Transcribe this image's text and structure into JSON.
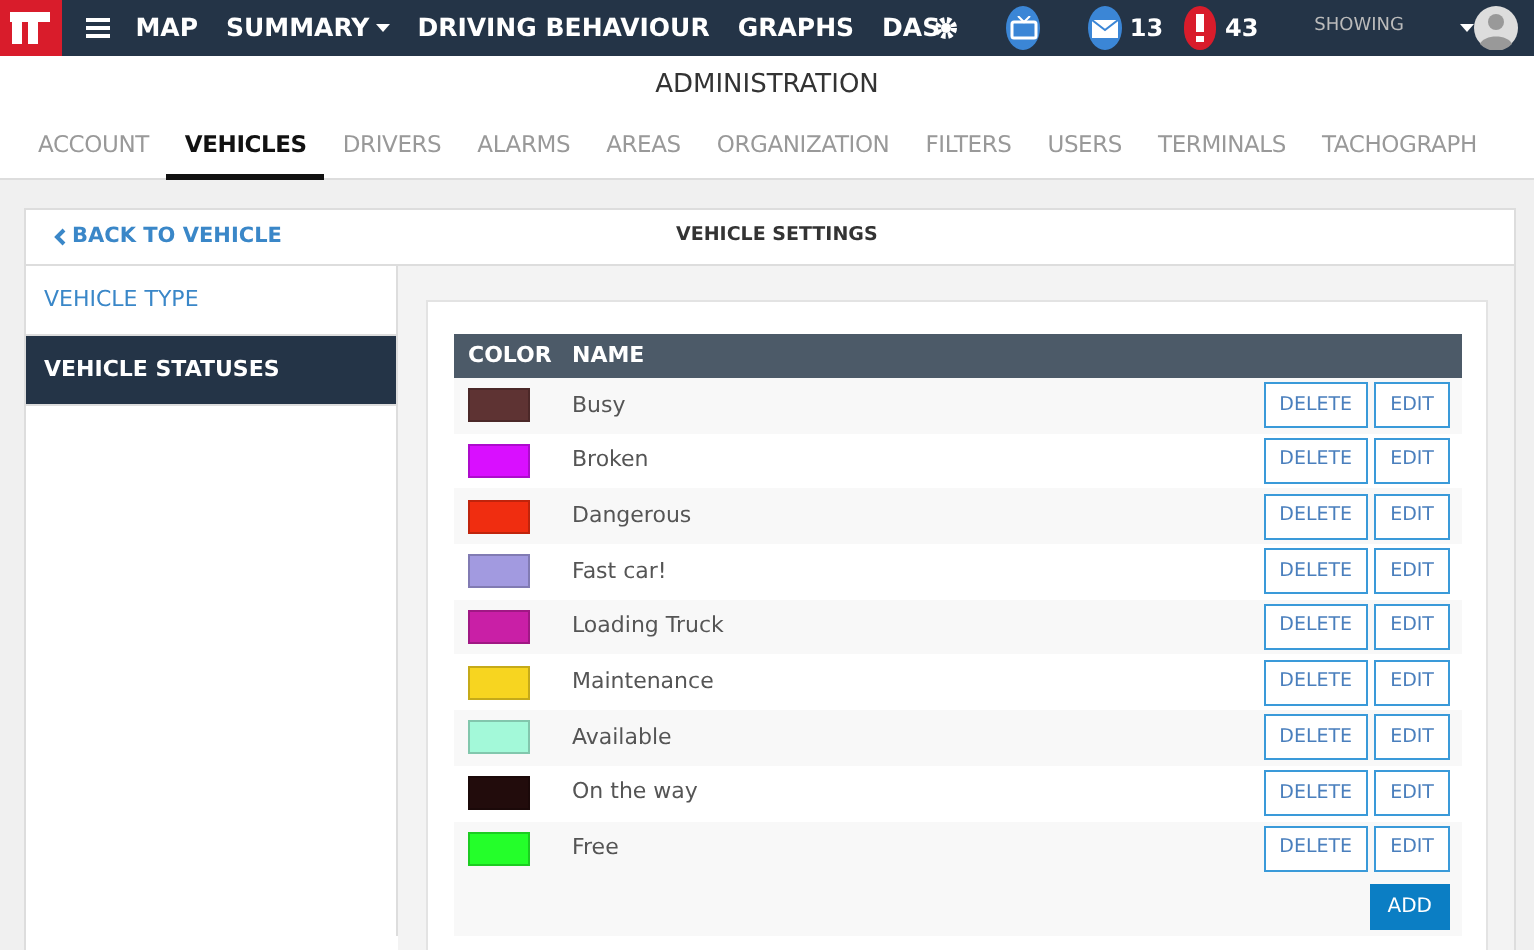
{
  "navbar": {
    "menu": [
      {
        "label": "MAP",
        "dropdown": false
      },
      {
        "label": "SUMMARY",
        "dropdown": true
      },
      {
        "label": "DRIVING BEHAVIOUR",
        "dropdown": false
      },
      {
        "label": "GRAPHS",
        "dropdown": false
      },
      {
        "label": "DAS",
        "dropdown": false
      }
    ],
    "messages_count": "13",
    "alerts_count": "43",
    "showing": "SHOWING"
  },
  "page_title": "ADMINISTRATION",
  "tabs": [
    {
      "label": "ACCOUNT",
      "selected": false
    },
    {
      "label": "VEHICLES",
      "selected": true
    },
    {
      "label": "DRIVERS",
      "selected": false
    },
    {
      "label": "ALARMS",
      "selected": false
    },
    {
      "label": "AREAS",
      "selected": false
    },
    {
      "label": "ORGANIZATION",
      "selected": false
    },
    {
      "label": "FILTERS",
      "selected": false
    },
    {
      "label": "USERS",
      "selected": false
    },
    {
      "label": "TERMINALS",
      "selected": false
    },
    {
      "label": "TACHOGRAPH",
      "selected": false
    }
  ],
  "back_link": "BACK TO VEHICLE",
  "panel_title": "VEHICLE SETTINGS",
  "sidebar": {
    "items": [
      {
        "label": "VEHICLE TYPE",
        "selected": false
      },
      {
        "label": "VEHICLE STATUSES",
        "selected": true
      }
    ]
  },
  "table": {
    "columns": [
      "COLOR",
      "NAME"
    ],
    "rows": [
      {
        "color": "#5e3333",
        "name": "Busy",
        "actions": [
          "DELETE",
          "EDIT"
        ]
      },
      {
        "color": "#d90fff",
        "name": "Broken",
        "actions": [
          "DELETE",
          "EDIT"
        ]
      },
      {
        "color": "#f02d10",
        "name": "Dangerous",
        "actions": [
          "DELETE",
          "EDIT"
        ]
      },
      {
        "color": "#a29ae0",
        "name": "Fast car!",
        "actions": [
          "DELETE",
          "EDIT"
        ]
      },
      {
        "color": "#c91fa6",
        "name": "Loading Truck",
        "actions": [
          "DELETE",
          "EDIT"
        ]
      },
      {
        "color": "#f7d520",
        "name": "Maintenance",
        "actions": [
          "DELETE",
          "EDIT"
        ]
      },
      {
        "color": "#a3f9d9",
        "name": "Available",
        "actions": [
          "DELETE",
          "EDIT"
        ]
      },
      {
        "color": "#220c0c",
        "name": "On the way",
        "actions": [
          "DELETE",
          "EDIT"
        ]
      },
      {
        "color": "#24ff2a",
        "name": "Free",
        "actions": [
          "DELETE",
          "EDIT"
        ]
      }
    ],
    "add_button": "ADD"
  }
}
